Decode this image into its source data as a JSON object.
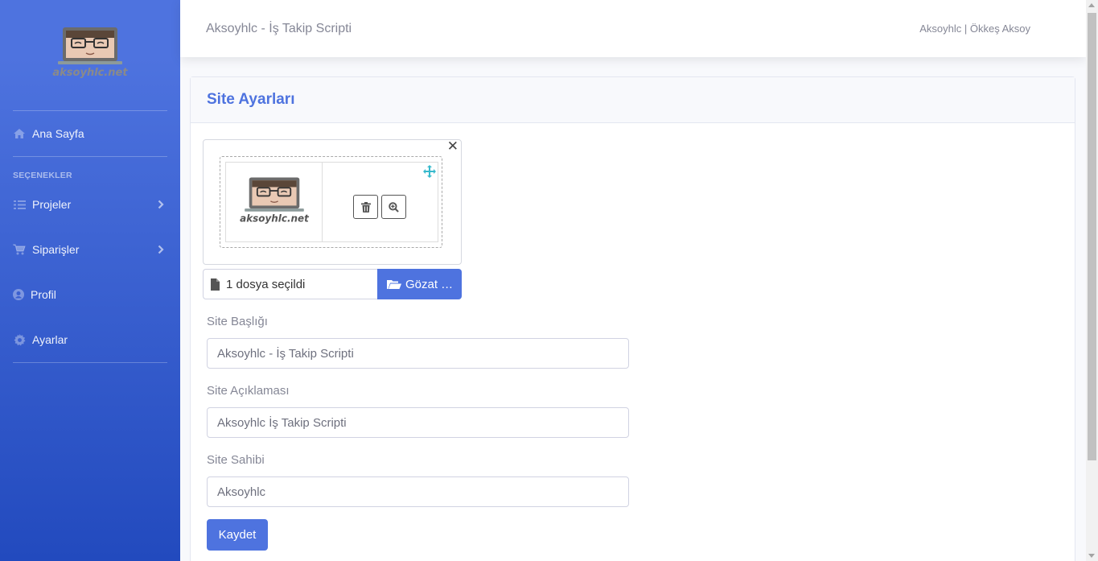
{
  "brand": {
    "logo_text": "aksoyhlc.net",
    "logo_icon": "laptop-face-logo"
  },
  "sidebar": {
    "section_heading": "SEÇENEKLER",
    "items": [
      {
        "label": "Ana Sayfa",
        "icon": "home-icon"
      },
      {
        "label": "Projeler",
        "icon": "tasks-icon",
        "has_submenu": true
      },
      {
        "label": "Siparişler",
        "icon": "cart-icon",
        "has_submenu": true
      },
      {
        "label": "Profil",
        "icon": "user-circle-icon"
      },
      {
        "label": "Ayarlar",
        "icon": "gear-icon"
      }
    ]
  },
  "topbar": {
    "title": "Aksoyhlc - İş Takip Scripti",
    "user": "Aksoyhlc | Ökkeş Aksoy"
  },
  "card": {
    "title": "Site Ayarları"
  },
  "file_input": {
    "caption": "1 dosya seçildi",
    "browse_label": "Gözat …",
    "preview_logo_text": "aksoyhlc.net"
  },
  "form": {
    "site_title_label": "Site Başlığı",
    "site_title_value": "Aksoyhlc - İş Takip Scripti",
    "site_desc_label": "Site Açıklaması",
    "site_desc_value": "Aksoyhlc İş Takip Scripti",
    "site_owner_label": "Site Sahibi",
    "site_owner_value": "Aksoyhlc",
    "save_label": "Kaydet"
  },
  "colors": {
    "primary": "#4e73df",
    "sidebar_end": "#224abe",
    "move_icon": "#36b9cc"
  }
}
